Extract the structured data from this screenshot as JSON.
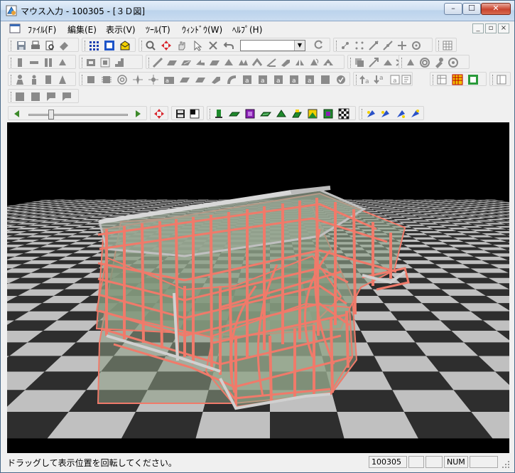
{
  "window": {
    "title": "マウス入力 - 100305 - [３Ｄ図]",
    "minimize_icon": "minimize-icon",
    "maximize_icon": "maximize-icon",
    "close_icon": "close-icon",
    "minimize_glyph": "–",
    "maximize_glyph": "☐",
    "close_glyph": "✕"
  },
  "menu": {
    "items": [
      "ﾌｧｲﾙ(F)",
      "編集(E)",
      "表示(V)",
      "ﾂｰﾙ(T)",
      "ｳｨﾝﾄﾞｳ(W)",
      "ﾍﾙﾌﾟ(H)"
    ],
    "mdi_buttons": [
      "_",
      "▫",
      "×"
    ]
  },
  "toolbar": {
    "combo_value": "",
    "slider_position": 0.2
  },
  "viewport": {
    "caption": "",
    "colors": {
      "background": "#000000",
      "floor_light": "#c0c0c0",
      "floor_dark": "#2e2e2e",
      "beam": "#f07a6a",
      "slab": "#8a9a82"
    }
  },
  "status": {
    "message": "ドラッグして表示位置を回転してください。",
    "job": "100305",
    "panel2": "",
    "panel3": "",
    "num": "NUM",
    "panel5": ""
  },
  "accent": "#d9272e"
}
